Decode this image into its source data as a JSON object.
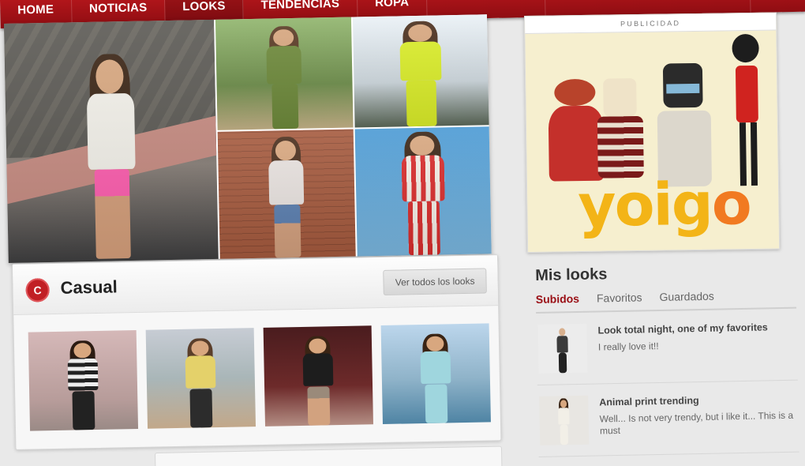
{
  "nav": {
    "items": [
      "HOME",
      "NOTICIAS",
      "LOOKS",
      "TENDENCIAS",
      "ROPA",
      "",
      ""
    ],
    "active_index": 2
  },
  "ad": {
    "label": "PUBLICIDAD",
    "brand": "yoigo"
  },
  "category": {
    "badge": "C",
    "title": "Casual",
    "view_all_label": "Ver todos los looks"
  },
  "mis_looks": {
    "title": "Mis looks",
    "tabs": [
      "Subidos",
      "Favoritos",
      "Guardados"
    ],
    "active_tab": 0,
    "items": [
      {
        "title": "Look total night, one of my favorites",
        "description": "I really love it!!"
      },
      {
        "title": "Animal print trending",
        "description": "Well... Is not very trendy, but i like it... This is a must"
      }
    ]
  },
  "colors": {
    "brand_red": "#a51218",
    "accent_red": "#c11f25",
    "ad_background": "#f6efcf",
    "yoigo_yellow": "#f3b417",
    "yoigo_orange": "#f17a21"
  }
}
